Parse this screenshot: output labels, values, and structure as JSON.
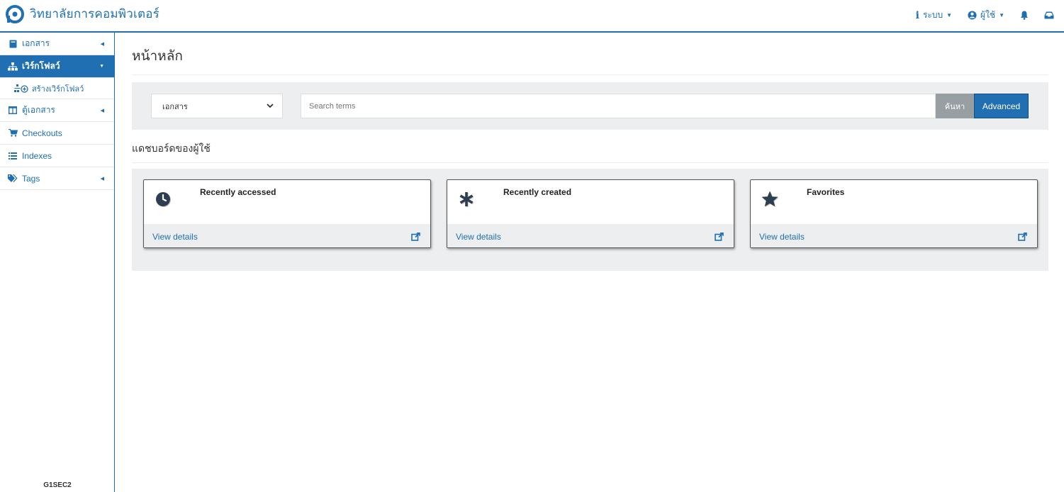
{
  "brand": {
    "name": "วิทยาลัยการคอมพิวเตอร์",
    "color": "#1f6fb2"
  },
  "topnav": {
    "system_label": "ระบบ",
    "user_label": "ผู้ใช้"
  },
  "sidebar": {
    "items": [
      {
        "label": "เอกสาร",
        "icon": "book-icon"
      },
      {
        "label": "เวิร์กโฟลว์",
        "icon": "sitemap-icon"
      },
      {
        "label": "สร้างเวิร์กโฟลว์",
        "icon": "sitemap-plus-icon"
      },
      {
        "label": "ตู้เอกสาร",
        "icon": "columns-icon"
      },
      {
        "label": "Checkouts",
        "icon": "cart-icon"
      },
      {
        "label": "Indexes",
        "icon": "list-icon"
      },
      {
        "label": "Tags",
        "icon": "tags-icon"
      }
    ],
    "footer": "G1SEC2"
  },
  "main": {
    "title": "หน้าหลัก",
    "search": {
      "select_value": "เอกสาร",
      "placeholder": "Search terms",
      "search_button": "ค้นหา",
      "advanced_button": "Advanced"
    },
    "dashboard_title": "แดชบอร์ดของผู้ใช้",
    "cards": [
      {
        "title": "Recently accessed",
        "icon": "clock-icon",
        "link": "View details"
      },
      {
        "title": "Recently created",
        "icon": "asterisk-icon",
        "link": "View details"
      },
      {
        "title": "Favorites",
        "icon": "star-icon",
        "link": "View details"
      }
    ]
  },
  "colors": {
    "accent": "#1f6fb2",
    "panel": "#eceeef",
    "search_btn": "#979fa3"
  }
}
